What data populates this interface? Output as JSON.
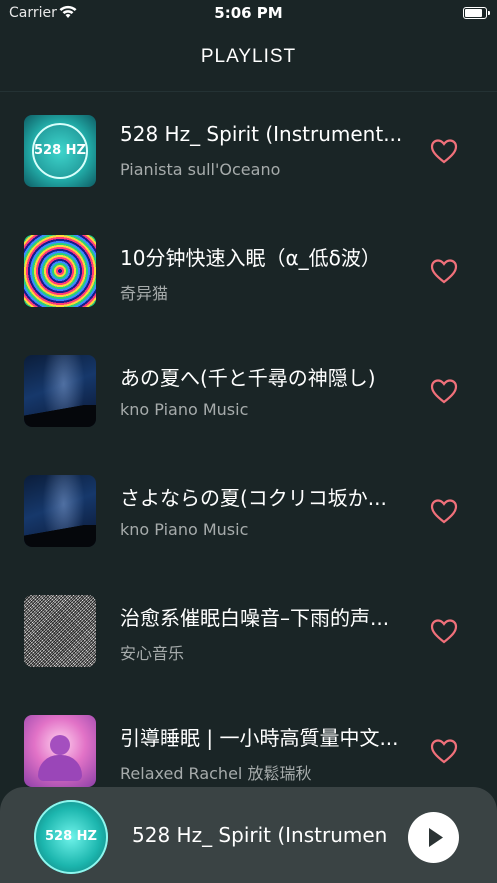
{
  "status_bar": {
    "carrier": "Carrier",
    "time": "5:06 PM",
    "battery_level": 0.95
  },
  "header": {
    "title": "PLAYLIST"
  },
  "playlist": [
    {
      "title": "528 Hz_ Spirit (Instrument...",
      "artist": "Pianista sull'Oceano",
      "art": "528-hz-art",
      "art_text": "528 HZ"
    },
    {
      "title": "10分钟快速入眠（α_低δ波）",
      "artist": "奇异猫",
      "art": "hypnotic-spiral-art",
      "art_text": ""
    },
    {
      "title": "あの夏へ(千と千尋の神隠し)",
      "artist": "kno Piano Music",
      "art": "night-sky-art",
      "art_text": ""
    },
    {
      "title": "さよならの夏(コクリコ坂か...",
      "artist": "kno Piano Music",
      "art": "night-sky-art",
      "art_text": ""
    },
    {
      "title": "治愈系催眠白噪音–下雨的声...",
      "artist": "安心音乐",
      "art": "white-noise-art",
      "art_text": ""
    },
    {
      "title": "引導睡眠 | 一小時高質量中文...",
      "artist": "Relaxed Rachel 放鬆瑞秋",
      "art": "meditation-art",
      "art_text": ""
    }
  ],
  "player": {
    "title": "528 Hz_ Spirit (Instrumen",
    "art_text": "528 HZ"
  },
  "colors": {
    "background": "#1a2526",
    "player_bg": "#3a4344",
    "heart": "#f0707a",
    "subtitle": "#a6abab"
  }
}
